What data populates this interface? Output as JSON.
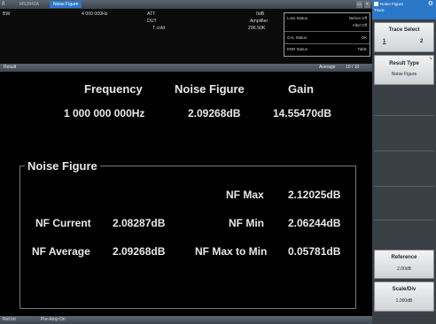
{
  "titlebar": {
    "logo": "/\\",
    "model": "MS2840A",
    "title": "Noise Figure",
    "btn_restore": "▭",
    "btn_close": "×"
  },
  "params": {
    "bw_label": "BW",
    "bw_value": "4 000 000Hz",
    "att_label": "ATT",
    "att_value": "0dB",
    "dut_label": "DUT",
    "dut_value": "Amplifier",
    "tcold_label": "T cold",
    "tcold_value": "296.50K"
  },
  "status": {
    "rows": [
      {
        "label": "Loss Status",
        "value": "Before:Off"
      },
      {
        "label": "",
        "value": "After:Off"
      },
      {
        "label": "CAL Status",
        "value": "OK"
      },
      {
        "label": "ENR Status",
        "value": "Table"
      }
    ]
  },
  "result_bar": {
    "label": "Result",
    "average": "Average",
    "count": "10 /   10"
  },
  "result": {
    "headers": {
      "frequency": "Frequency",
      "noise_figure": "Noise Figure",
      "gain": "Gain"
    },
    "values": {
      "frequency": "1 000 000 000Hz",
      "noise_figure": "2.09268dB",
      "gain": "14.55470dB"
    },
    "nf_section": {
      "title": "Noise Figure",
      "nf_max_label": "NF Max",
      "nf_max_value": "2.12025dB",
      "nf_current_label": "NF Current",
      "nf_current_value": "2.08287dB",
      "nf_min_label": "NF Min",
      "nf_min_value": "2.06244dB",
      "nf_average_label": "NF Average",
      "nf_average_value": "2.09268dB",
      "nf_max_to_min_label": "NF Max to Min",
      "nf_max_to_min_value": "0.05781dB"
    }
  },
  "bottom": {
    "ref_int": "Ref.Int",
    "preamp": "Pre-Amp On"
  },
  "panel": {
    "head_line1": "Noise Figure",
    "head_line2": "Trace",
    "gear_icon": "gear-icon",
    "trace_select": {
      "title": "Trace Select",
      "opt1": "1",
      "opt2": "2"
    },
    "result_type": {
      "title": "Result Type",
      "value": "Noise Figure"
    },
    "reference": {
      "title": "Reference",
      "value": "2.00dB"
    },
    "scale_div": {
      "title": "Scale/Div",
      "value": "1.000dB"
    }
  },
  "colors": {
    "accent": "#2b77c8",
    "background": "#000000",
    "bar": "#4a535c"
  }
}
